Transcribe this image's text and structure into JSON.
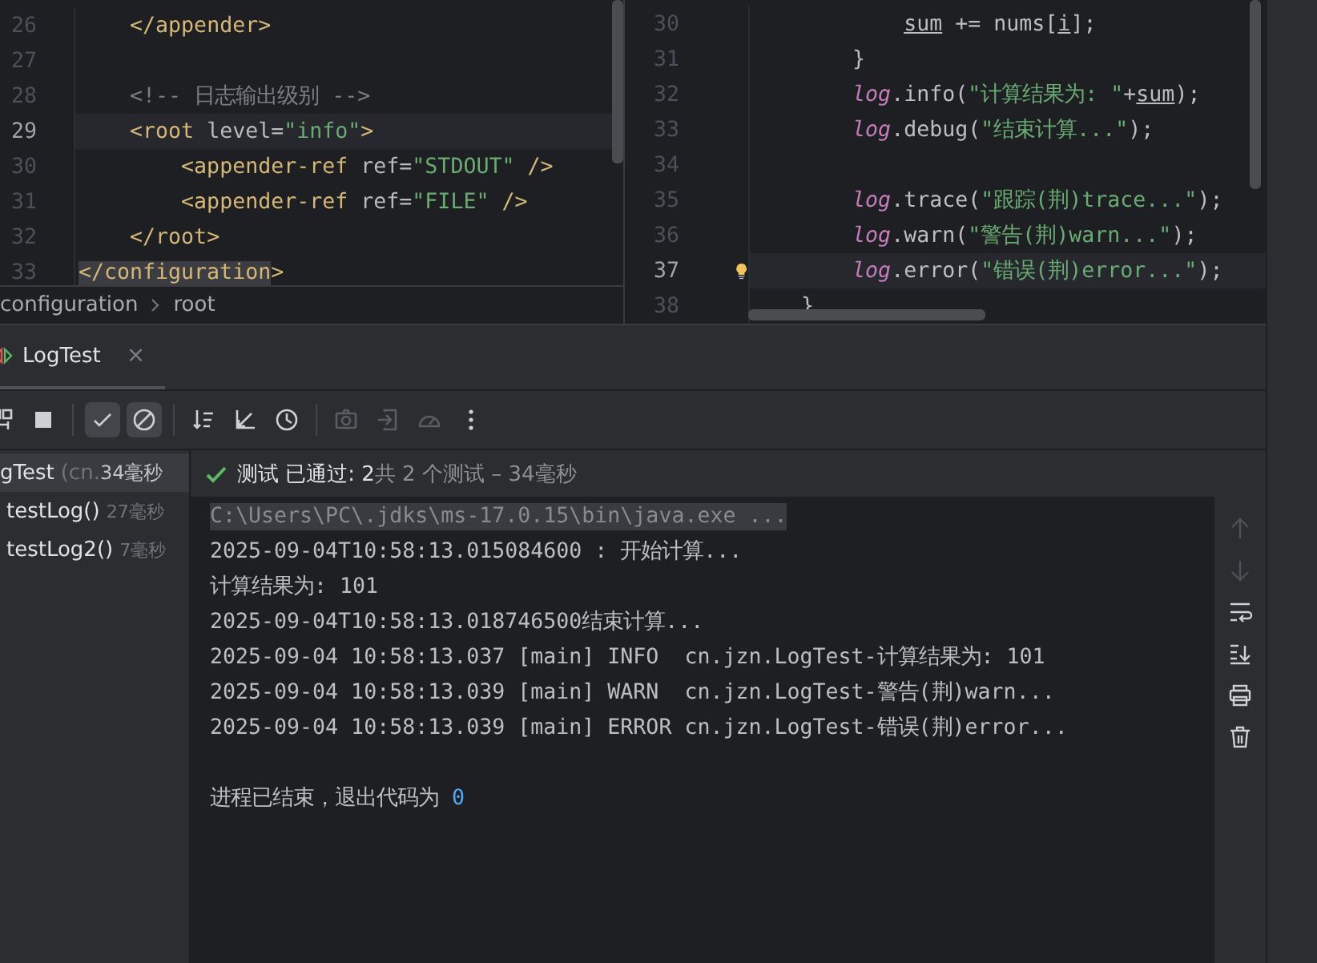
{
  "editor_left": {
    "lines": [
      {
        "number": "26",
        "current": false,
        "tokens": [
          {
            "kind": "tag",
            "text": "    </appender>"
          }
        ]
      },
      {
        "number": "27",
        "current": false
      },
      {
        "number": "28",
        "current": false,
        "tokens": [
          {
            "kind": "comment",
            "text": "    <!-- 日志输出级别 -->"
          }
        ]
      },
      {
        "number": "29",
        "current": true,
        "tokens": [
          {
            "kind": "tag",
            "text": "    <root"
          },
          {
            "kind": "attr",
            "text": " level="
          },
          {
            "kind": "string",
            "text": "\"info\""
          },
          {
            "kind": "tag",
            "text": ">"
          }
        ]
      },
      {
        "number": "30",
        "current": false,
        "tokens": [
          {
            "kind": "tag",
            "text": "        <appender-ref"
          },
          {
            "kind": "attr",
            "text": " ref="
          },
          {
            "kind": "string",
            "text": "\"STDOUT\""
          },
          {
            "kind": "tag",
            "text": " />"
          }
        ]
      },
      {
        "number": "31",
        "current": false,
        "tokens": [
          {
            "kind": "tag",
            "text": "        <appender-ref"
          },
          {
            "kind": "attr",
            "text": " ref="
          },
          {
            "kind": "string",
            "text": "\"FILE\""
          },
          {
            "kind": "tag",
            "text": " />"
          }
        ]
      },
      {
        "number": "32",
        "current": false,
        "tokens": [
          {
            "kind": "tag",
            "text": "    </root>"
          }
        ]
      },
      {
        "number": "33",
        "current": false,
        "tokens": [
          {
            "kind": "tag-match",
            "text": "</configuration"
          },
          {
            "kind": "tag",
            "text": ">"
          }
        ]
      }
    ],
    "breadcrumb": [
      "configuration",
      "root"
    ]
  },
  "editor_right": {
    "lines": [
      {
        "number": "30",
        "current": false,
        "hint": false,
        "tokens": [
          {
            "kind": "underlined",
            "text": "            sum"
          },
          {
            "kind": "plain",
            "text": " += nums["
          },
          {
            "kind": "underlined",
            "text": "i"
          },
          {
            "kind": "plain",
            "text": "];"
          }
        ]
      },
      {
        "number": "31",
        "current": false,
        "hint": false,
        "tokens": [
          {
            "kind": "plain",
            "text": "        }"
          }
        ]
      },
      {
        "number": "32",
        "current": false,
        "hint": false,
        "tokens": [
          {
            "kind": "field",
            "text": "        log"
          },
          {
            "kind": "plain",
            "text": ".info("
          },
          {
            "kind": "string",
            "text": "\"计算结果为: \""
          },
          {
            "kind": "plain",
            "text": "+"
          },
          {
            "kind": "underlined",
            "text": "sum"
          },
          {
            "kind": "plain",
            "text": ");"
          }
        ]
      },
      {
        "number": "33",
        "current": false,
        "hint": false,
        "tokens": [
          {
            "kind": "field",
            "text": "        log"
          },
          {
            "kind": "plain",
            "text": ".debug("
          },
          {
            "kind": "string",
            "text": "\"结束计算...\""
          },
          {
            "kind": "plain",
            "text": ");"
          }
        ]
      },
      {
        "number": "34",
        "current": false,
        "hint": false
      },
      {
        "number": "35",
        "current": false,
        "hint": false,
        "tokens": [
          {
            "kind": "field",
            "text": "        log"
          },
          {
            "kind": "plain",
            "text": ".trace("
          },
          {
            "kind": "string",
            "text": "\"跟踪(荆)trace...\""
          },
          {
            "kind": "plain",
            "text": ");"
          }
        ]
      },
      {
        "number": "36",
        "current": false,
        "hint": false,
        "tokens": [
          {
            "kind": "field",
            "text": "        log"
          },
          {
            "kind": "plain",
            "text": ".warn("
          },
          {
            "kind": "string",
            "text": "\"警告(荆)warn...\""
          },
          {
            "kind": "plain",
            "text": ");"
          }
        ]
      },
      {
        "number": "37",
        "current": true,
        "hint": true,
        "tokens": [
          {
            "kind": "field",
            "text": "        log"
          },
          {
            "kind": "plain",
            "text": ".error("
          },
          {
            "kind": "string",
            "text": "\"错误(荆)error...\""
          },
          {
            "kind": "plain",
            "text": ");"
          }
        ]
      },
      {
        "number": "38",
        "current": false,
        "hint": false,
        "tokens": [
          {
            "kind": "plain",
            "text": "    }"
          }
        ]
      }
    ]
  },
  "run_tab": {
    "title": "LogTest",
    "close": "×"
  },
  "toolbar": [
    {
      "kind": "button",
      "selected": false,
      "disabled": false
    },
    {
      "kind": "button",
      "selected": false,
      "disabled": false
    },
    {
      "kind": "separator"
    },
    {
      "kind": "button",
      "selected": true,
      "disabled": false
    },
    {
      "kind": "button",
      "selected": true,
      "disabled": false
    },
    {
      "kind": "separator"
    },
    {
      "kind": "button",
      "selected": false,
      "disabled": false
    },
    {
      "kind": "button",
      "selected": false,
      "disabled": false
    },
    {
      "kind": "button",
      "selected": false,
      "disabled": false
    },
    {
      "kind": "separator"
    },
    {
      "kind": "button",
      "selected": false,
      "disabled": true
    },
    {
      "kind": "button",
      "selected": false,
      "disabled": true
    },
    {
      "kind": "button",
      "selected": false,
      "disabled": true
    },
    {
      "kind": "button",
      "selected": false,
      "disabled": false
    }
  ],
  "tree": {
    "name": "gTest",
    "detail": "(cn.",
    "time": "34毫秒",
    "selected": true,
    "children": [
      {
        "name": "testLog()",
        "time": "27毫秒",
        "selected": false
      },
      {
        "name": "testLog2()",
        "time": "7毫秒",
        "selected": false
      }
    ]
  },
  "status": {
    "result": "测试 已通过: 2",
    "summary": "共 2 个测试 – 34毫秒"
  },
  "console": [
    {
      "kind": "command",
      "text": "C:\\Users\\PC\\.jdks\\ms-17.0.15\\bin\\java.exe ..."
    },
    {
      "kind": "plain",
      "text": "2025-09-04T10:58:13.015084600 : 开始计算..."
    },
    {
      "kind": "plain",
      "text": "计算结果为: 101"
    },
    {
      "kind": "plain",
      "text": "2025-09-04T10:58:13.018746500结束计算..."
    },
    {
      "kind": "plain",
      "text": "2025-09-04 10:58:13.037 [main] INFO  cn.jzn.LogTest-计算结果为: 101"
    },
    {
      "kind": "plain",
      "text": "2025-09-04 10:58:13.039 [main] WARN  cn.jzn.LogTest-警告(荆)warn..."
    },
    {
      "kind": "plain",
      "text": "2025-09-04 10:58:13.039 [main] ERROR cn.jzn.LogTest-错误(荆)error..."
    },
    {
      "kind": "blank"
    },
    {
      "kind": "exit",
      "text": "进程已结束，退出代码为 ",
      "code": "0"
    }
  ],
  "console_tools": [
    {
      "disabled": true
    },
    {
      "disabled": true
    },
    {
      "disabled": false
    },
    {
      "disabled": false
    },
    {
      "disabled": false
    },
    {
      "disabled": false
    }
  ]
}
